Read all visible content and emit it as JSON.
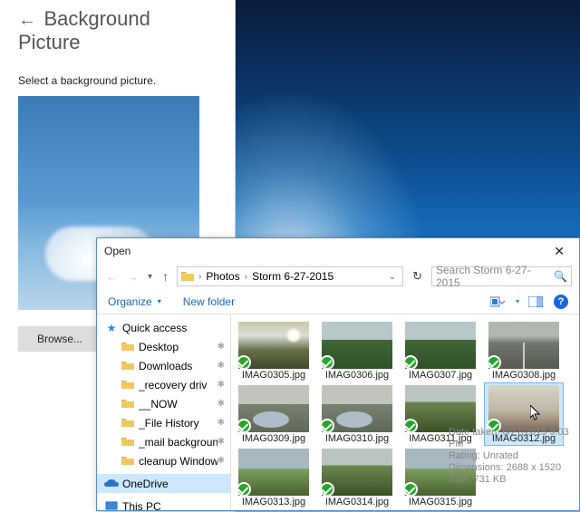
{
  "panel": {
    "back_glyph": "←",
    "title": "Background Picture",
    "instruction": "Select a background picture.",
    "browse_label": "Browse..."
  },
  "dialog": {
    "title": "Open",
    "close_glyph": "✕",
    "nav_back_glyph": "←",
    "nav_fwd_glyph": "→",
    "nav_chevron": "▾",
    "nav_up_glyph": "↑",
    "breadcrumb_sep": "›",
    "breadcrumb": [
      "Photos",
      "Storm 6-27-2015"
    ],
    "breadcrumb_drop": "⌄",
    "refresh_glyph": "↻",
    "search_placeholder": "Search Storm 6-27-2015",
    "search_glyph": "🔍",
    "organize_label": "Organize",
    "organize_tri": "▾",
    "newfolder_label": "New folder",
    "view_tri": "▾",
    "help_glyph": "?",
    "selected_file": "IMAG0312.jpg",
    "tooltip": {
      "line1": "Date taken: 6/27/2015 9:03 PM",
      "line2": "Rating: Unrated",
      "line3": "Dimensions: 2688 x 1520",
      "line4": "Size: 731 KB"
    }
  },
  "navtree": {
    "quick_access": "Quick access",
    "star_glyph": "★",
    "pin_glyph": "✱",
    "items": [
      {
        "label": "Desktop"
      },
      {
        "label": "Downloads"
      },
      {
        "label": "_recovery driv"
      },
      {
        "label": "__NOW"
      },
      {
        "label": "_File History"
      },
      {
        "label": "_mail backgroun"
      },
      {
        "label": "cleanup Window"
      }
    ],
    "onedrive": "OneDrive",
    "thispc": "This PC"
  },
  "files": [
    {
      "name": "IMAG0305.jpg",
      "style": "sky1"
    },
    {
      "name": "IMAG0306.jpg",
      "style": "field1"
    },
    {
      "name": "IMAG0307.jpg",
      "style": "field1"
    },
    {
      "name": "IMAG0308.jpg",
      "style": "road"
    },
    {
      "name": "IMAG0309.jpg",
      "style": "puddle"
    },
    {
      "name": "IMAG0310.jpg",
      "style": "puddle"
    },
    {
      "name": "IMAG0311.jpg",
      "style": "grass"
    },
    {
      "name": "IMAG0312.jpg",
      "style": "cloudy"
    },
    {
      "name": "IMAG0313.jpg",
      "style": "field2"
    },
    {
      "name": "IMAG0314.jpg",
      "style": "grass"
    },
    {
      "name": "IMAG0315.jpg",
      "style": "field2"
    }
  ]
}
